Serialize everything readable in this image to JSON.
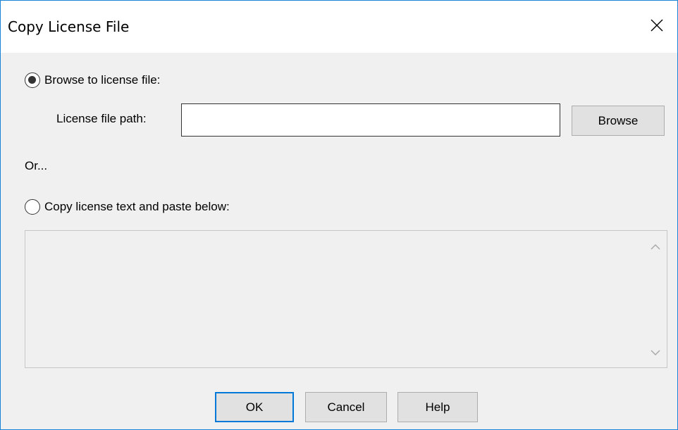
{
  "window": {
    "title": "Copy License File"
  },
  "option_browse": {
    "label": "Browse to license file:",
    "selected": true
  },
  "license_path": {
    "label": "License file path:",
    "value": "",
    "browse_label": "Browse"
  },
  "or_text": "Or...",
  "option_paste": {
    "label": "Copy license text and paste below:",
    "selected": false
  },
  "paste_area": {
    "value": ""
  },
  "footer": {
    "ok_label": "OK",
    "cancel_label": "Cancel",
    "help_label": "Help"
  },
  "icons": {
    "close": "close-icon",
    "scroll_up": "chevron-up-icon",
    "scroll_down": "chevron-down-icon"
  },
  "colors": {
    "window_border": "#1883d7",
    "dialog_background": "#f0f0f0",
    "default_button_border": "#0078d7",
    "button_background": "#e1e1e1"
  }
}
